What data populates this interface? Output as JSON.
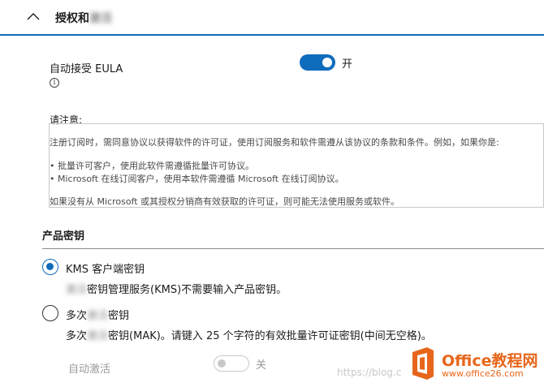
{
  "section": {
    "title": "授权和",
    "title_blurred": "激活"
  },
  "eula": {
    "label": "自动接受 EULA",
    "toggle_state": "开",
    "info_glyph": "i"
  },
  "notice": {
    "heading": "请注意:",
    "line1": "注册订阅时，需同意协议以获得软件的许可证，使用订阅服务和软件需遵从该协议的条款和条件。例如，如果你是:",
    "bullet1": "• 批量许可客户，使用此软件需遵循批量许可协议。",
    "bullet2": "• Microsoft 在线订阅客户，使用本软件需遵循 Microsoft 在线订阅协议。",
    "footer": "如果没有从 Microsoft 或其授权分销商有效获取的许可证，则可能无法使用服务或软件。"
  },
  "product_key": {
    "heading": "产品密钥",
    "options": [
      {
        "label": "KMS 客户端密钥",
        "desc_blurred": "激活",
        "desc": "密钥管理服务(KMS)不需要输入产品密钥。",
        "selected": true
      },
      {
        "label_prefix": "多次",
        "label_blurred": "激活",
        "label_suffix": "密钥",
        "desc_prefix": "多次",
        "desc_blurred": "激活",
        "desc": "密钥(MAK)。请键入 25 个字符的有效批量许可证密钥(中间无空格)。",
        "selected": false
      }
    ],
    "auto_activate": {
      "label": "自动激活",
      "toggle_state": "关"
    }
  },
  "watermark": "https://blog.c",
  "logo": {
    "text": "Office教程网",
    "url": "www.office26.com"
  },
  "colors": {
    "accent": "#0f6cbd",
    "logo_orange": "#e7661b"
  }
}
